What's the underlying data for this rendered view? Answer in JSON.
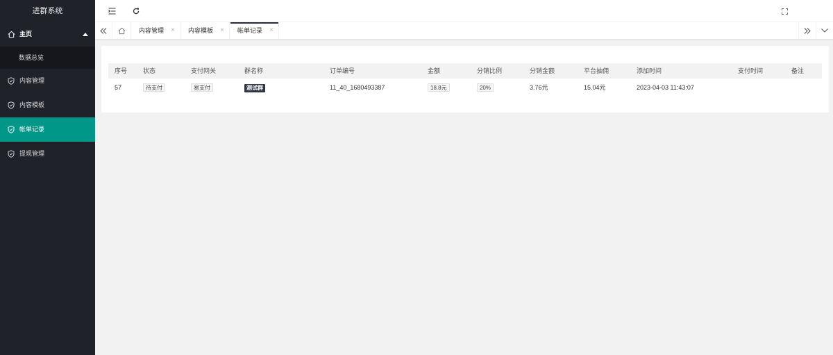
{
  "app": {
    "title": "进群系统"
  },
  "sidebar": {
    "home": {
      "label": "主页"
    },
    "home_sub": [
      {
        "label": "数据总览"
      }
    ],
    "items": [
      {
        "label": "内容管理"
      },
      {
        "label": "内容模板"
      },
      {
        "label": "帐单记录",
        "active": true
      },
      {
        "label": "提现管理"
      }
    ]
  },
  "tabs": {
    "items": [
      {
        "label": "内容管理"
      },
      {
        "label": "内容模板"
      },
      {
        "label": "帐单记录",
        "active": true
      }
    ],
    "close_glyph": "×"
  },
  "table": {
    "headers": [
      "序号",
      "状态",
      "支付网关",
      "群名称",
      "订单编号",
      "金额",
      "分销比例",
      "分销金额",
      "平台抽佣",
      "添加时间",
      "支付时间",
      "备注"
    ],
    "rows": [
      {
        "id": "57",
        "status": "待支付",
        "gateway": "易支付",
        "group": "测试群",
        "order_no": "11_40_1680493387",
        "amount": "18.8元",
        "ratio": "20%",
        "commission": "3.76元",
        "platform_fee": "15.04元",
        "created_at": "2023-04-03 11:43:07",
        "paid_at": "",
        "remark": ""
      }
    ]
  },
  "colors": {
    "accent": "#009688",
    "sidebar_bg": "#20222a",
    "sub_bg": "#16171c"
  },
  "icons": {
    "menu": "menu-toggle-icon",
    "refresh": "refresh-icon",
    "fullscreen": "fullscreen-icon",
    "home": "home-icon",
    "shield": "shield-check-icon"
  }
}
